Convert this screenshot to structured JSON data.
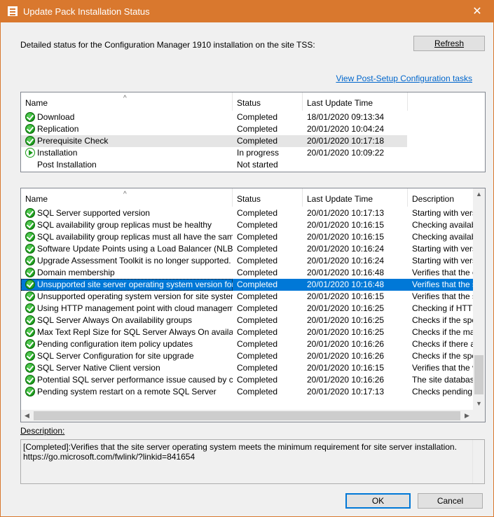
{
  "window": {
    "title": "Update Pack Installation Status",
    "close_glyph": "✕"
  },
  "intro_text": "Detailed status for the Configuration Manager 1910 installation on the site TSS:",
  "refresh_label": "Refresh",
  "post_setup_link": "View Post-Setup Configuration tasks",
  "top_list": {
    "columns": [
      "Name",
      "Status",
      "Last Update Time"
    ],
    "rows": [
      {
        "icon": "completed-check-icon",
        "name": "Download",
        "status": "Completed",
        "time": "18/01/2020 09:13:34"
      },
      {
        "icon": "completed-check-icon",
        "name": "Replication",
        "status": "Completed",
        "time": "20/01/2020 10:04:24"
      },
      {
        "icon": "completed-check-icon",
        "name": "Prerequisite Check",
        "status": "Completed",
        "time": "20/01/2020 10:17:18"
      },
      {
        "icon": "in-progress-play-icon",
        "name": "Installation",
        "status": "In progress",
        "time": "20/01/2020 10:09:22"
      },
      {
        "icon": "",
        "name": "Post Installation",
        "status": "Not started",
        "time": ""
      }
    ]
  },
  "bottom_list": {
    "columns": [
      "Name",
      "Status",
      "Last Update Time",
      "Description"
    ],
    "rows": [
      {
        "name": "SQL Server supported version",
        "status": "Completed",
        "time": "20/01/2020 10:17:13",
        "desc": "Starting with versio"
      },
      {
        "name": "SQL availability group replicas must be healthy",
        "status": "Completed",
        "time": "20/01/2020 10:16:15",
        "desc": "Checking availabili"
      },
      {
        "name": "SQL availability group replicas must all have the same se...",
        "status": "Completed",
        "time": "20/01/2020 10:16:15",
        "desc": "Checking availabili"
      },
      {
        "name": "Software Update Points using a Load Balancer (NLB/HL...",
        "status": "Completed",
        "time": "20/01/2020 10:16:24",
        "desc": "Starting with versio"
      },
      {
        "name": "Upgrade Assessment Toolkit is no longer supported.",
        "status": "Completed",
        "time": "20/01/2020 10:16:24",
        "desc": "Starting with versio"
      },
      {
        "name": "Domain membership",
        "status": "Completed",
        "time": "20/01/2020 10:16:48",
        "desc": "Verifies that the co"
      },
      {
        "name": "Unsupported site server operating system version for Set...",
        "status": "Completed",
        "time": "20/01/2020 10:16:48",
        "desc": "Verifies that the site"
      },
      {
        "name": "Unsupported operating system version for site system role",
        "status": "Completed",
        "time": "20/01/2020 10:16:15",
        "desc": "Verifies that the site"
      },
      {
        "name": "Using HTTP management point with cloud management ...",
        "status": "Completed",
        "time": "20/01/2020 10:16:25",
        "desc": "Checking if HTTP"
      },
      {
        "name": "SQL Server Always On availability groups",
        "status": "Completed",
        "time": "20/01/2020 10:16:25",
        "desc": "Checks if the spec"
      },
      {
        "name": "Max Text Repl Size for SQL Server Always On availabilit...",
        "status": "Completed",
        "time": "20/01/2020 10:16:25",
        "desc": "Checks if the max t"
      },
      {
        "name": "Pending configuration item policy updates",
        "status": "Completed",
        "time": "20/01/2020 10:16:26",
        "desc": "Checks if there are"
      },
      {
        "name": "SQL Server Configuration for site upgrade",
        "status": "Completed",
        "time": "20/01/2020 10:16:26",
        "desc": "Checks if the spec"
      },
      {
        "name": "SQL Server Native Client version",
        "status": "Completed",
        "time": "20/01/2020 10:16:15",
        "desc": "Verifies that the ve"
      },
      {
        "name": "Potential SQL server performance issue caused by chan...",
        "status": "Completed",
        "time": "20/01/2020 10:16:26",
        "desc": "The site database"
      },
      {
        "name": "Pending system restart on a remote SQL Server",
        "status": "Completed",
        "time": "20/01/2020 10:17:13",
        "desc": "Checks pending sy"
      }
    ]
  },
  "description_label": "Description:",
  "description_line1": "[Completed]:Verifies that the site server operating system meets the minimum requirement for site server installation.",
  "description_line2": "https://go.microsoft.com/fwlink/?linkid=841654",
  "ok_label": "OK",
  "cancel_label": "Cancel",
  "colors": {
    "titlebar": "#d9782e",
    "selection": "#0078d7",
    "link": "#0066cc"
  }
}
